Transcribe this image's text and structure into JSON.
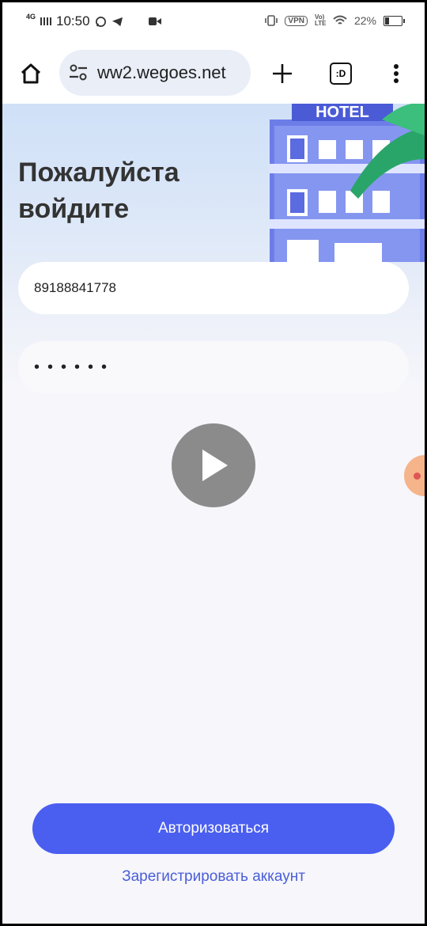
{
  "status_bar": {
    "network": "4G",
    "time": "10:50",
    "vpn": "VPN",
    "volte": "Vo) LTE",
    "battery": "22%"
  },
  "browser": {
    "url": "ww2.wegoes.net",
    "tab_switcher": ":D"
  },
  "page": {
    "hero_sign": "HOTEL",
    "title_line1": "Пожалуйста",
    "title_line2": "войдите",
    "phone_value": "89188841778",
    "password_mask": "••••••",
    "login_button": "Авторизоваться",
    "register_link": "Зарегистрировать аккаунт"
  },
  "colors": {
    "primary": "#4a5ef0",
    "link": "#4a5ed8",
    "hero": "#cfe0f7"
  },
  "icons": {
    "home": "home-icon",
    "site_settings": "site-settings-icon",
    "new_tab": "plus-icon",
    "menu": "more-vert-icon",
    "play": "play-icon"
  }
}
